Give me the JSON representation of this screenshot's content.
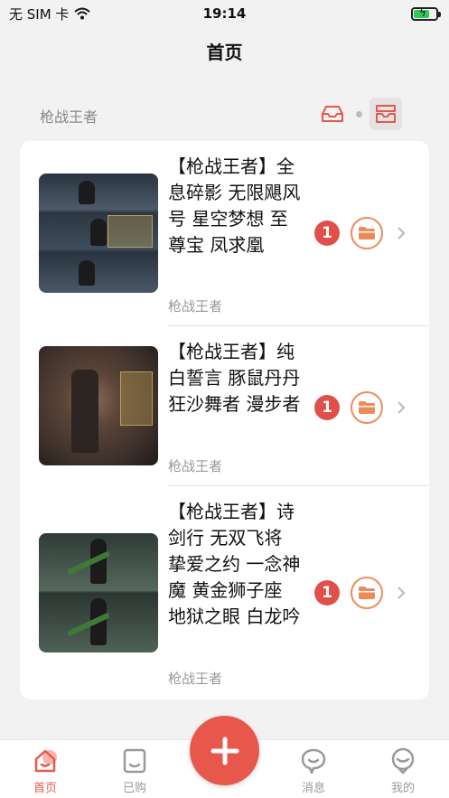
{
  "status_bar": {
    "carrier": "无 SIM 卡",
    "time": "19:14"
  },
  "nav": {
    "title": "首页"
  },
  "section": {
    "title": "枪战王者"
  },
  "items": [
    {
      "title": "【枪战王者】全息碎影 无限飓风号 星空梦想 至尊宝 凤求凰",
      "subtitle": "枪战王者",
      "badge": "1"
    },
    {
      "title": "【枪战王者】纯白誓言 豚鼠丹丹 狂沙舞者 漫步者",
      "subtitle": "枪战王者",
      "badge": "1"
    },
    {
      "title": "【枪战王者】诗剑行 无双飞将 挚爱之约 一念神魔 黄金狮子座 地狱之眼 白龙吟",
      "subtitle": "枪战王者",
      "badge": "1"
    }
  ],
  "tabs": [
    {
      "label": "首页",
      "icon": "home-icon",
      "active": true
    },
    {
      "label": "已购",
      "icon": "bag-icon",
      "active": false
    },
    {
      "label": "消息",
      "icon": "chat-icon",
      "active": false
    },
    {
      "label": "我的",
      "icon": "profile-icon",
      "active": false
    }
  ],
  "colors": {
    "accent": "#e8574b",
    "folder": "#ee8a5a",
    "badge": "#e0504a",
    "battery": "#35c759"
  }
}
